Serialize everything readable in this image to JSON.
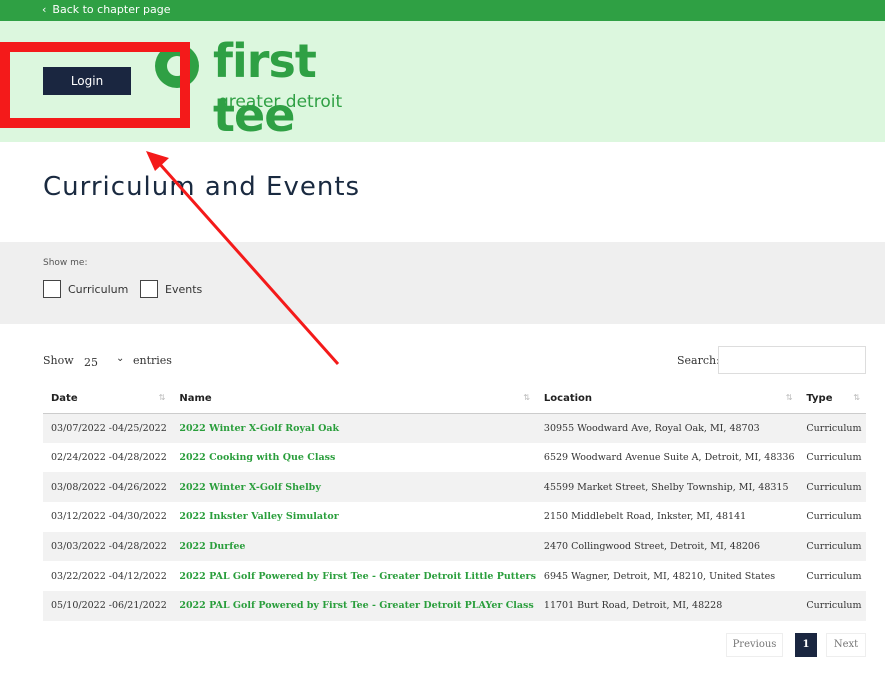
{
  "topbar": {
    "back_label": "Back to chapter page"
  },
  "header": {
    "login_label": "Login",
    "logo_word": "first tee",
    "logo_sub": "greater detroit"
  },
  "page": {
    "title": "Curriculum and Events"
  },
  "filters": {
    "label": "Show me:",
    "options": [
      {
        "label": "Curriculum",
        "checked": false
      },
      {
        "label": "Events",
        "checked": false
      }
    ]
  },
  "table_controls": {
    "show_label": "Show",
    "page_size": "25",
    "entries_label": "entries",
    "search_label": "Search:",
    "search_value": ""
  },
  "table": {
    "columns": [
      "Date",
      "Name",
      "Location",
      "Type"
    ],
    "rows": [
      {
        "date": "03/07/2022 -04/25/2022",
        "name": "2022 Winter X-Golf Royal Oak",
        "location": "30955 Woodward Ave, Royal Oak, MI, 48703",
        "type": "Curriculum"
      },
      {
        "date": "02/24/2022 -04/28/2022",
        "name": "2022 Cooking with Que Class",
        "location": "6529 Woodward Avenue Suite A, Detroit, MI, 48336",
        "type": "Curriculum"
      },
      {
        "date": "03/08/2022 -04/26/2022",
        "name": "2022 Winter X-Golf Shelby",
        "location": "45599 Market Street, Shelby Township, MI, 48315",
        "type": "Curriculum"
      },
      {
        "date": "03/12/2022 -04/30/2022",
        "name": "2022 Inkster Valley Simulator",
        "location": "2150 Middlebelt Road, Inkster, MI, 48141",
        "type": "Curriculum"
      },
      {
        "date": "03/03/2022 -04/28/2022",
        "name": "2022 Durfee",
        "location": "2470 Collingwood Street, Detroit, MI, 48206",
        "type": "Curriculum"
      },
      {
        "date": "03/22/2022 -04/12/2022",
        "name": "2022 PAL Golf Powered by First Tee - Greater Detroit Little Putters",
        "location": "6945 Wagner, Detroit, MI, 48210, United States",
        "type": "Curriculum"
      },
      {
        "date": "05/10/2022 -06/21/2022",
        "name": "2022 PAL Golf Powered by First Tee - Greater Detroit PLAYer Class",
        "location": "11701 Burt Road, Detroit, MI, 48228",
        "type": "Curriculum"
      }
    ]
  },
  "pagination": {
    "previous": "Previous",
    "current": "1",
    "next": "Next"
  },
  "colors": {
    "brand_green": "#2fa044",
    "navy": "#1a2640",
    "annotation_red": "#f41a1a"
  },
  "icons": [
    "chevron-left-icon",
    "chevron-down-icon",
    "sort-icon",
    "first-tee-ball-icon"
  ]
}
